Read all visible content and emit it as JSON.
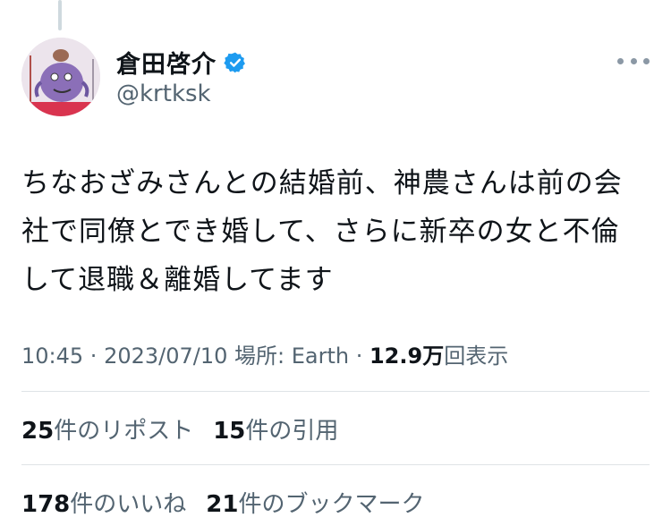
{
  "author": {
    "display_name": "倉田啓介",
    "handle": "@krtksk",
    "verified": true
  },
  "tweet": {
    "text": "ちなおざみさんとの結婚前、神農さんは前の会\n社で同僚とでき婚して、さらに新卒の女と不倫\nして退職＆離婚してます"
  },
  "meta": {
    "time": "10:45",
    "sep1": " · ",
    "date": "2023/07/10",
    "location": " 場所: Earth",
    "sep2": " · ",
    "views_count": "12.9万",
    "views_label": "回表示"
  },
  "stats": {
    "reposts_count": "25",
    "reposts_label": "件のリポスト",
    "quotes_count": "15",
    "quotes_label": "件の引用",
    "likes_count": "178",
    "likes_label": "件のいいね",
    "bookmarks_count": "21",
    "bookmarks_label": "件のブックマーク"
  },
  "icons": {
    "verified": "verified-badge-icon",
    "more": "more-options-icon"
  },
  "colors": {
    "verified": "#1d9bf0",
    "secondary_text": "#536471",
    "primary_text": "#0f1419",
    "divider": "#dfe3e6"
  }
}
